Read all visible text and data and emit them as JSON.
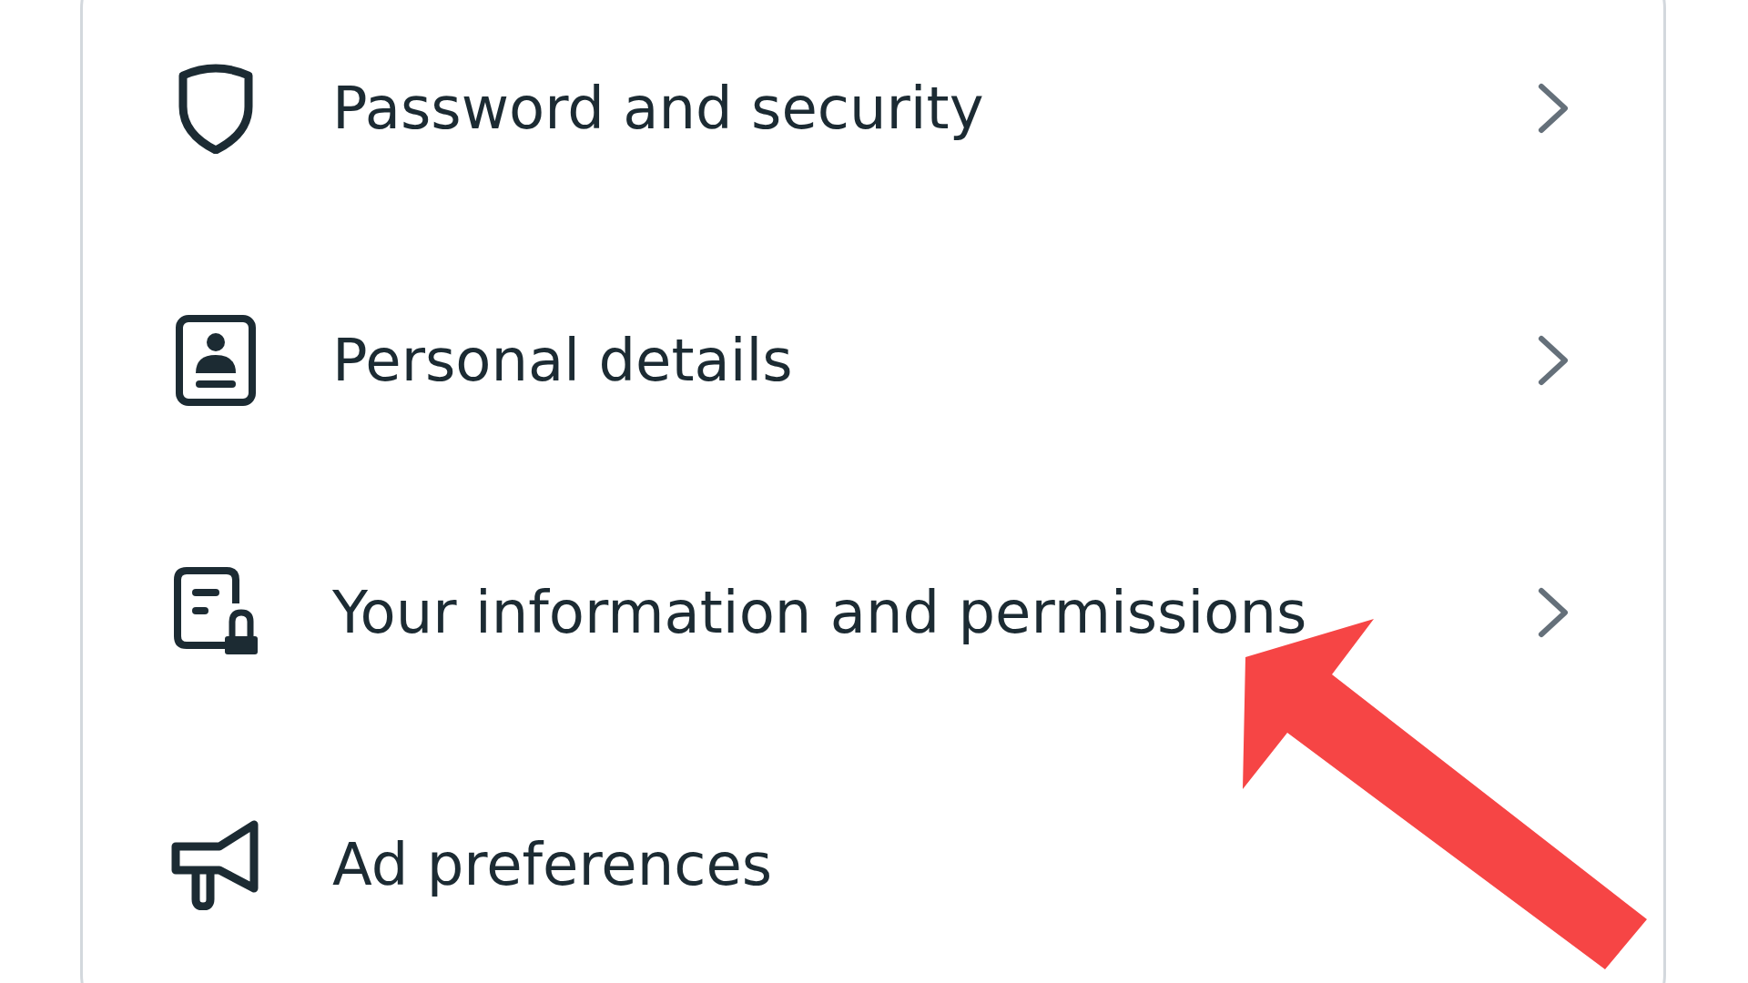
{
  "menu": {
    "items": [
      {
        "kind": "shield",
        "label": "Password and security"
      },
      {
        "kind": "id-card",
        "label": "Personal details"
      },
      {
        "kind": "document-lock",
        "label": "Your information and permissions"
      },
      {
        "kind": "megaphone",
        "label": "Ad preferences"
      }
    ]
  }
}
